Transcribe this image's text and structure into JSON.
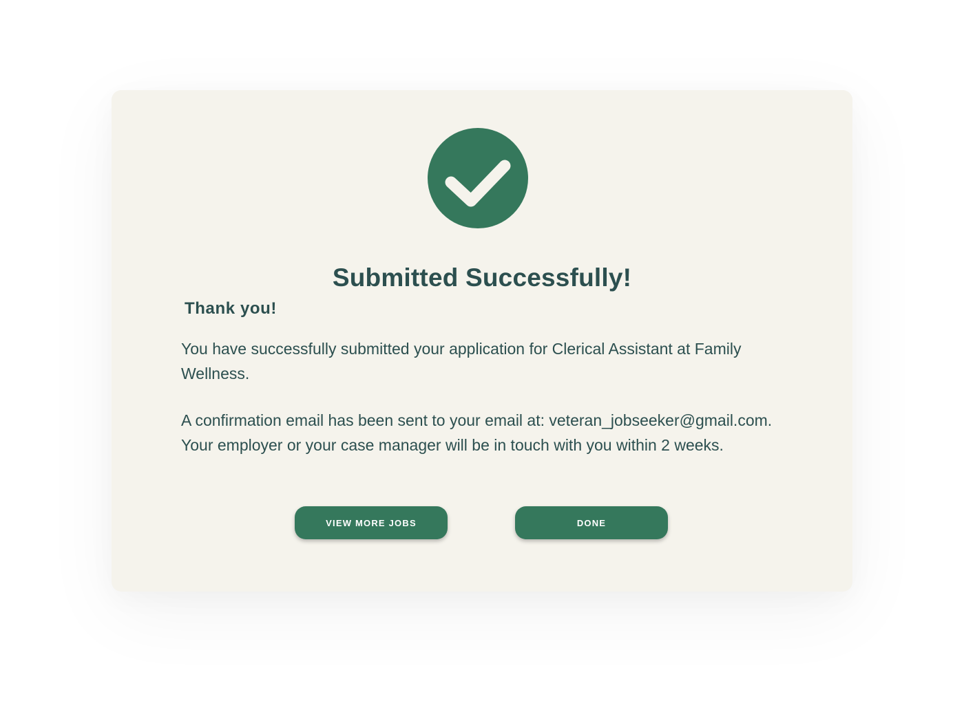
{
  "dialog": {
    "icon": "check-circle-icon",
    "title": "Submitted Successfully!",
    "thanks": "Thank you!",
    "message_1": "You have successfully submitted your application for Clerical Assistant at Family Wellness.",
    "message_2": "A confirmation email has been sent to your email at: veteran_jobseeker@gmail.com. Your employer or your case manager will be in touch with you within 2 weeks.",
    "buttons": {
      "view_more_jobs": "VIEW MORE JOBS",
      "done": "DONE"
    }
  },
  "colors": {
    "accent": "#35785c",
    "text": "#2c4f4f",
    "card_background": "#f5f3ec",
    "page_background": "#ffffff"
  }
}
